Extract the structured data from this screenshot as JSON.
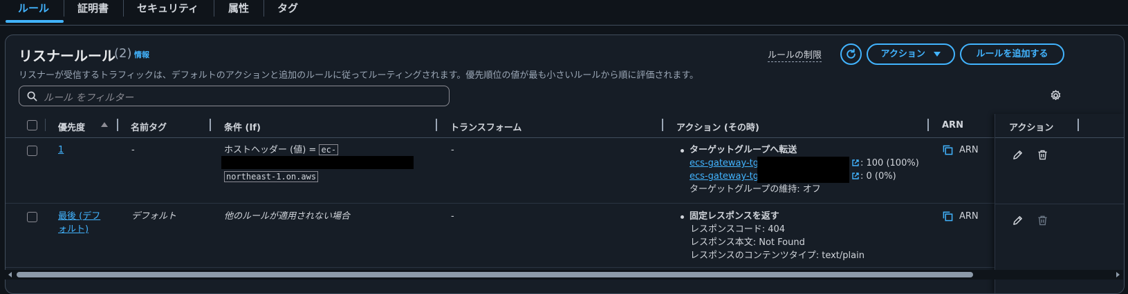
{
  "tabs": [
    "ルール",
    "証明書",
    "セキュリティ",
    "属性",
    "タグ"
  ],
  "panel": {
    "title": "リスナールール",
    "count": "(2)",
    "info": "情報",
    "description": "リスナーが受信するトラフィックは、デフォルトのアクションと追加のルールに従ってルーティングされます。優先順位の値が最も小さいルールから順に評価されます。",
    "limit_link": "ルールの制限",
    "actions_button": "アクション",
    "add_rule_button": "ルールを追加する",
    "search_placeholder": "ルール をフィルター"
  },
  "table": {
    "headers": [
      "優先度",
      "名前タグ",
      "条件 (If)",
      "トランスフォーム",
      "アクション (その時)",
      "ARN",
      "アクション"
    ],
    "rows": [
      {
        "priority": "1",
        "name": "-",
        "condition_prefix": "ホストヘッダー (値) =",
        "condition_code_1": "ec-",
        "condition_code_2": "northeast-1.on.aws",
        "transform": "-",
        "action_title": "ターゲットグループへ転送",
        "tg1_link": "ecs-gateway-tg-",
        "tg1_weight": ": 100 (100%)",
        "tg2_link": "ecs-gateway-tg-",
        "tg2_weight": ": 0 (0%)",
        "stickiness": "ターゲットグループの維持: オフ",
        "arn": "ARN"
      },
      {
        "priority_line1": "最後 (デフ",
        "priority_line2": "ォルト)",
        "name": "デフォルト",
        "condition": "他のルールが適用されない場合",
        "transform": "-",
        "action_title": "固定レスポンスを返す",
        "response_code": "レスポンスコード: 404",
        "response_body": "レスポンス本文: Not Found",
        "content_type": "レスポンスのコンテンツタイプ: text/plain",
        "arn": "ARN"
      }
    ]
  },
  "colors": {
    "accent": "#42b4ff",
    "background": "#0f141a",
    "panel": "#161d26",
    "border": "#414d5c"
  }
}
